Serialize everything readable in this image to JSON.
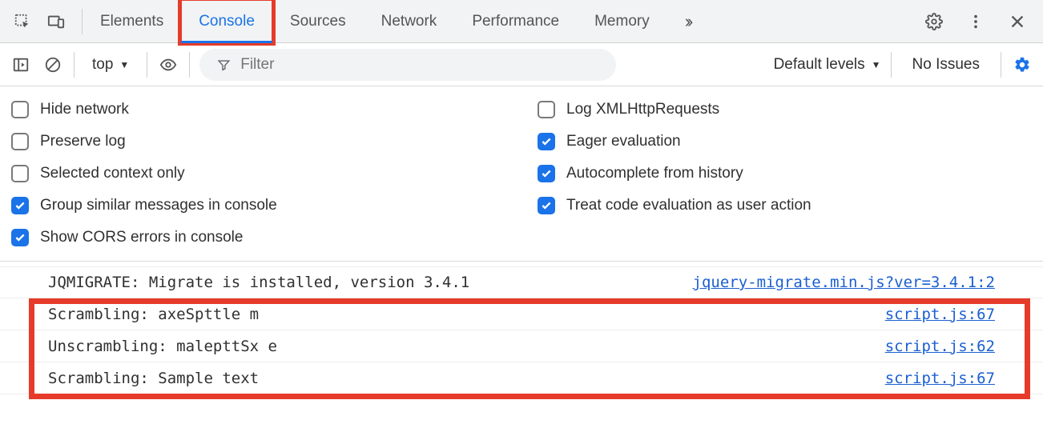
{
  "tabs": {
    "elements": "Elements",
    "console": "Console",
    "sources": "Sources",
    "network": "Network",
    "performance": "Performance",
    "memory": "Memory"
  },
  "subbar": {
    "context": "top",
    "filter_placeholder": "Filter",
    "levels": "Default levels",
    "noissues": "No Issues"
  },
  "options": {
    "hide_network": {
      "label": "Hide network",
      "checked": false
    },
    "log_xhr": {
      "label": "Log XMLHttpRequests",
      "checked": false
    },
    "preserve_log": {
      "label": "Preserve log",
      "checked": false
    },
    "eager_eval": {
      "label": "Eager evaluation",
      "checked": true
    },
    "selected_ctx": {
      "label": "Selected context only",
      "checked": false
    },
    "autocomplete": {
      "label": "Autocomplete from history",
      "checked": true
    },
    "group_similar": {
      "label": "Group similar messages in console",
      "checked": true
    },
    "treat_code": {
      "label": "Treat code evaluation as user action",
      "checked": true
    },
    "show_cors": {
      "label": "Show CORS errors in console",
      "checked": true
    }
  },
  "logs": [
    {
      "msg": "JQMIGRATE: Migrate is installed, version 3.4.1",
      "src": "jquery-migrate.min.js?ver=3.4.1:2"
    },
    {
      "msg": "Scrambling: axeSpttle m",
      "src": "script.js:67"
    },
    {
      "msg": "Unscrambling: malepttSx e",
      "src": "script.js:62"
    },
    {
      "msg": "Scrambling: Sample text",
      "src": "script.js:67"
    }
  ]
}
